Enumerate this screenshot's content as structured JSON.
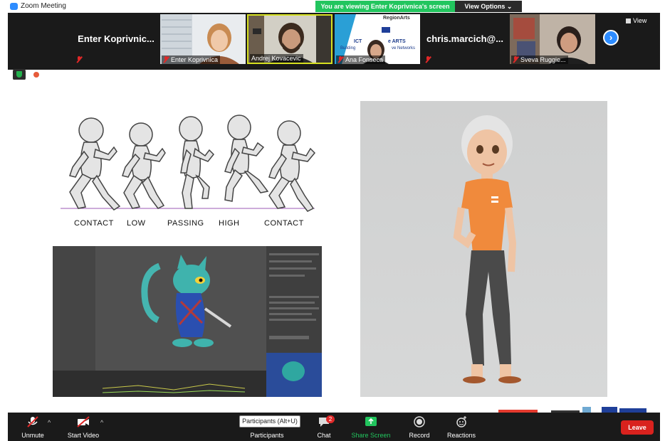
{
  "window": {
    "title": "Zoom Meeting"
  },
  "banner": {
    "text": "You are viewing Enter Koprivnica's screen",
    "view_options": "View Options"
  },
  "gallery": {
    "tiles": [
      {
        "name": "Enter  Koprivnic...",
        "type": "name_only"
      },
      {
        "name": "Enter Koprivnica",
        "type": "video"
      },
      {
        "name": "Andrej Kovacevic",
        "type": "video"
      },
      {
        "name": "Ana Fonseca",
        "type": "video"
      },
      {
        "name": "chris.marcich@...",
        "type": "name_only"
      },
      {
        "name": "Sveva Ruggie...",
        "type": "video"
      }
    ],
    "view_label": "View",
    "slide_text": [
      "RegionArts",
      "ICT",
      "e ARTS",
      "Building",
      "ve Networks"
    ]
  },
  "slide": {
    "walk_cycle_labels": [
      "CONTACT",
      "LOW",
      "PASSING",
      "HIGH",
      "CONTACT"
    ]
  },
  "toolbar": {
    "unmute": "Unmute",
    "start_video": "Start Video",
    "participants": "Participants",
    "participants_tooltip": "Participants (Alt+U)",
    "chat": "Chat",
    "chat_badge": "2",
    "share_screen": "Share Screen",
    "record": "Record",
    "reactions": "Reactions",
    "leave": "Leave"
  },
  "colors": {
    "accent": "#2d8cff",
    "share": "#22c55e",
    "leave": "#d9221e",
    "muted": "#e02828"
  }
}
